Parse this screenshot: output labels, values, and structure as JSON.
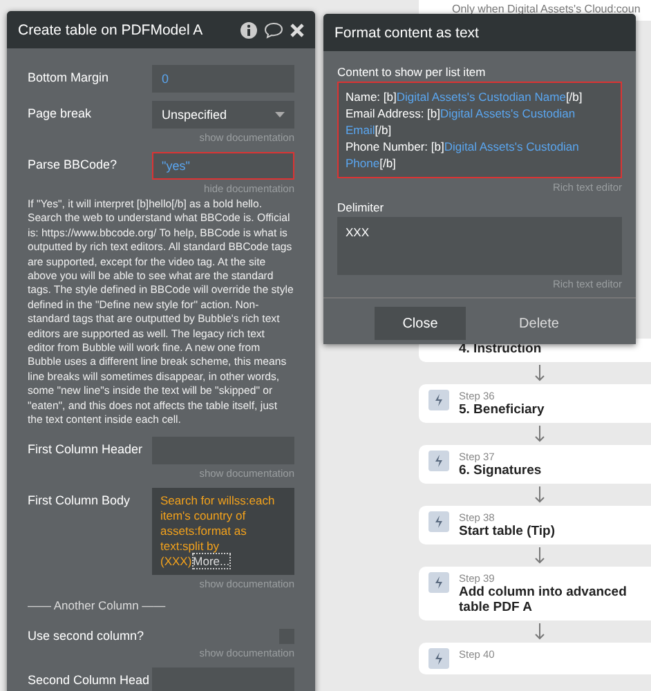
{
  "canvas": {
    "condition": "Only when Digital Assets's Cloud:coun",
    "steps": [
      {
        "title": "4. Instruction"
      },
      {
        "step": "Step 36",
        "title": "5. Beneficiary"
      },
      {
        "step": "Step 37",
        "title": "6. Signatures"
      },
      {
        "step": "Step 38",
        "title": "Start table (Tip)"
      },
      {
        "step": "Step 39",
        "title": "Add column into advanced table PDF A"
      },
      {
        "step": "Step 40"
      }
    ]
  },
  "left_panel": {
    "title": "Create table on PDFModel A",
    "fields": [
      {
        "kind": "input",
        "label": "Bottom Margin",
        "value": "0"
      },
      {
        "kind": "dropdown",
        "label": "Page break",
        "value": "Unspecified",
        "doc": "show documentation"
      },
      {
        "kind": "input",
        "label": "Parse BBCode?",
        "value": "\"yes\"",
        "highlighted": true,
        "doc": "hide documentation"
      },
      {
        "kind": "text",
        "text": "If \"Yes\", it will interpret [b]hello[/b] as a bold hello. Search the web to understand what BBCode is. Official is: https://www.bbcode.org/ To help, BBCode is what is outputted by rich text editors.  All standard BBCode tags are supported, except for the video tag. At the site above you will be able to see what are the standard tags.  The style defined in BBCode will override the style defined in the \"Define new style for\" action.  Non-standard tags that are outputted by Bubble's rich text editors are supported as well. The legacy rich text editor from Bubble will work fine. A new one from Bubble uses a different line break scheme, this means line breaks will sometimes disappear, in other words, some \"new line\"s inside the text will be \"skipped\" or \"eaten\", and this does not affects the table itself, just the text content inside each cell."
      },
      {
        "kind": "input",
        "label": "First Column Header",
        "doc": "show documentation"
      },
      {
        "kind": "expression",
        "label": "First Column Body",
        "value": "Search for willss:each item's country of assets:format as text:split by (XXX)",
        "more": "More...",
        "doc": "show documentation"
      },
      {
        "kind": "section",
        "text": "—— Another Column ——"
      },
      {
        "kind": "checkbox",
        "label": "Use second column?",
        "checked": false,
        "doc": "show documentation"
      },
      {
        "kind": "input",
        "label": "Second Column Head"
      }
    ]
  },
  "right_panel": {
    "title": "Format content as text",
    "content_label": "Content to show per list item",
    "content": [
      [
        {
          "kind": "plain",
          "text": "Name: [b]"
        },
        {
          "kind": "dynamic",
          "text": "Digital Assets's Custodian Name"
        },
        {
          "kind": "plain",
          "text": "[/b]"
        }
      ],
      [
        {
          "kind": "plain",
          "text": "Email Address: [b]"
        },
        {
          "kind": "dynamic",
          "text": "Digital Assets's Custodian Email"
        },
        {
          "kind": "plain",
          "text": "[/b]"
        }
      ],
      [
        {
          "kind": "plain",
          "text": "Phone Number: [b]"
        },
        {
          "kind": "dynamic",
          "text": "Digital Assets's Custodian Phone"
        },
        {
          "kind": "plain",
          "text": "[/b]"
        }
      ]
    ],
    "content_hint": "Rich text editor",
    "delimiter_label": "Delimiter",
    "delimiter": "XXX",
    "delimiter_hint": "Rich text editor",
    "buttons": [
      {
        "kind": "primary",
        "label": "Close"
      },
      {
        "kind": "plain",
        "label": "Delete"
      }
    ]
  }
}
